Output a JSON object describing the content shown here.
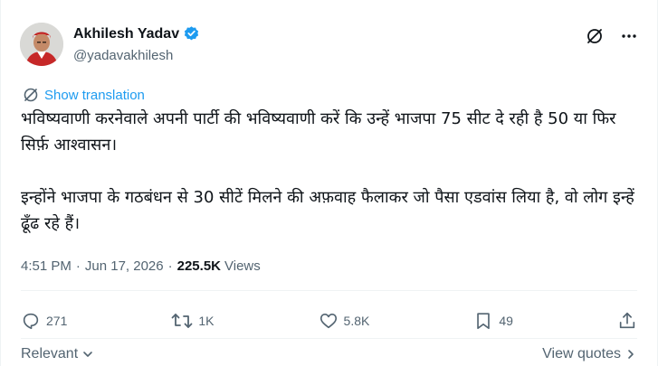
{
  "author": {
    "name": "Akhilesh Yadav",
    "handle": "@yadavakhilesh"
  },
  "translation": {
    "label": "Show translation"
  },
  "tweet": {
    "paragraph1": "भविष्यवाणी करनेवाले अपनी पार्टी की भविष्यवाणी करें कि उन्हें भाजपा 75 सीट दे रही है 50 या फिर सिर्फ़ आश्वासन।",
    "paragraph2": "इन्होंने भाजपा के गठबंधन से 30 सीटें मिलने की अफ़वाह फैलाकर जो पैसा एडवांस लिया है, वो लोग इन्हें ढूँढ रहे हैं।"
  },
  "meta": {
    "time": "4:51 PM",
    "separator": "·",
    "date": "Jun 17, 2026",
    "views_count": "225.5K",
    "views_label": "Views"
  },
  "actions": {
    "replies": "271",
    "reposts": "1K",
    "likes": "5.8K",
    "bookmarks": "49"
  },
  "bottom": {
    "sort_label": "Relevant",
    "view_quotes": "View quotes"
  },
  "colors": {
    "accent": "#1d9bf0",
    "secondary_text": "#536471",
    "primary_text": "#0f1419",
    "divider": "#eff3f4"
  }
}
